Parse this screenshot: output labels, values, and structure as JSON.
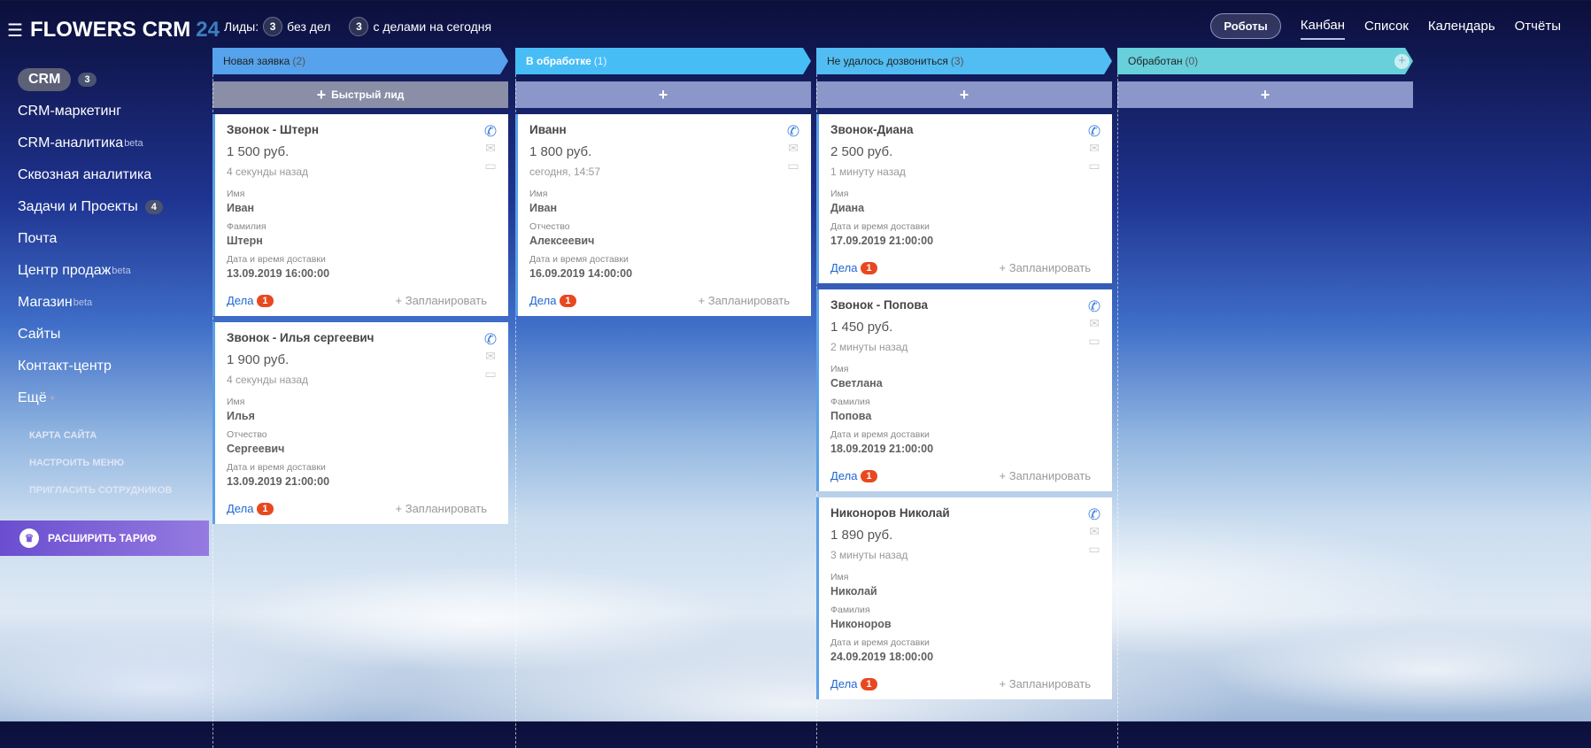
{
  "app": {
    "title": "FLOWERS CRM",
    "suffix": "24"
  },
  "stats": {
    "label": "Лиды:",
    "no_deals_count": "3",
    "no_deals_label": "без дел",
    "today_count": "3",
    "today_label": "с делами на сегодня"
  },
  "topnav": {
    "robots": "Роботы",
    "tabs": [
      "Канбан",
      "Список",
      "Календарь",
      "Отчёты"
    ]
  },
  "sidebar": {
    "items": [
      {
        "label": "CRM",
        "count": "3",
        "active": true
      },
      {
        "label": "CRM-маркетинг"
      },
      {
        "label": "CRM-аналитика",
        "sup": "beta"
      },
      {
        "label": "Сквозная аналитика"
      },
      {
        "label": "Задачи и Проекты",
        "count": "4"
      },
      {
        "label": "Почта"
      },
      {
        "label": "Центр продаж",
        "sup": "beta"
      },
      {
        "label": "Магазин",
        "sup": "beta"
      },
      {
        "label": "Сайты"
      },
      {
        "label": "Контакт-центр"
      },
      {
        "label": "Ещё",
        "arrow": true
      }
    ],
    "links": [
      "КАРТА САЙТА",
      "НАСТРОИТЬ МЕНЮ",
      "ПРИГЛАСИТЬ СОТРУДНИКОВ"
    ],
    "upgrade": "РАСШИРИТЬ ТАРИФ"
  },
  "card_labels": {
    "deals": "Дела",
    "plan": "+ Запланировать"
  },
  "colors": {
    "col1": "#56a2ec",
    "col2": "#47bdf6",
    "col3": "#52bdf2",
    "col4": "#67d0db",
    "quick1": "#8a8ea6",
    "quick": "rgba(160,172,220,.85)"
  },
  "columns": [
    {
      "title": "Новая заявка",
      "count": "(2)",
      "quick": "Быстрый лид",
      "cards": [
        {
          "title": "Звонок - Штерн",
          "price": "1 500 руб.",
          "time": "4 секунды назад",
          "fields": [
            {
              "label": "Имя",
              "value": "Иван"
            },
            {
              "label": "Фамилия",
              "value": "Штерн"
            },
            {
              "label": "Дата и время доставки",
              "value": "13.09.2019 16:00:00"
            }
          ],
          "deals": "1"
        },
        {
          "title": "Звонок - Илья сергеевич",
          "price": "1 900 руб.",
          "time": "4 секунды назад",
          "fields": [
            {
              "label": "Имя",
              "value": "Илья"
            },
            {
              "label": "Отчество",
              "value": "Сергеевич"
            },
            {
              "label": "Дата и время доставки",
              "value": "13.09.2019 21:00:00"
            }
          ],
          "deals": "1"
        }
      ]
    },
    {
      "title": "В обработке",
      "count": "(1)",
      "quick": "",
      "cards": [
        {
          "title": "Иванн",
          "price": "1 800 руб.",
          "time": "сегодня, 14:57",
          "fields": [
            {
              "label": "Имя",
              "value": "Иван"
            },
            {
              "label": "Отчество",
              "value": "Алексеевич"
            },
            {
              "label": "Дата и время доставки",
              "value": "16.09.2019 14:00:00"
            }
          ],
          "deals": "1"
        }
      ]
    },
    {
      "title": "Не удалось дозвониться",
      "count": "(3)",
      "quick": "",
      "cards": [
        {
          "title": "Звонок-Диана",
          "price": "2 500 руб.",
          "time": "1 минуту назад",
          "fields": [
            {
              "label": "Имя",
              "value": "Диана"
            },
            {
              "label": "Дата и время доставки",
              "value": "17.09.2019 21:00:00"
            }
          ],
          "deals": "1"
        },
        {
          "title": "Звонок - Попова",
          "price": "1 450 руб.",
          "time": "2 минуты назад",
          "fields": [
            {
              "label": "Имя",
              "value": "Светлана"
            },
            {
              "label": "Фамилия",
              "value": "Попова"
            },
            {
              "label": "Дата и время доставки",
              "value": "18.09.2019 21:00:00"
            }
          ],
          "deals": "1"
        },
        {
          "title": "Никоноров Николай",
          "price": "1 890 руб.",
          "time": "3 минуты назад",
          "fields": [
            {
              "label": "Имя",
              "value": "Николай"
            },
            {
              "label": "Фамилия",
              "value": "Никоноров"
            },
            {
              "label": "Дата и время доставки",
              "value": "24.09.2019 18:00:00"
            }
          ],
          "deals": "1"
        }
      ]
    },
    {
      "title": "Обработан",
      "count": "(0)",
      "quick": "",
      "cards": []
    }
  ]
}
